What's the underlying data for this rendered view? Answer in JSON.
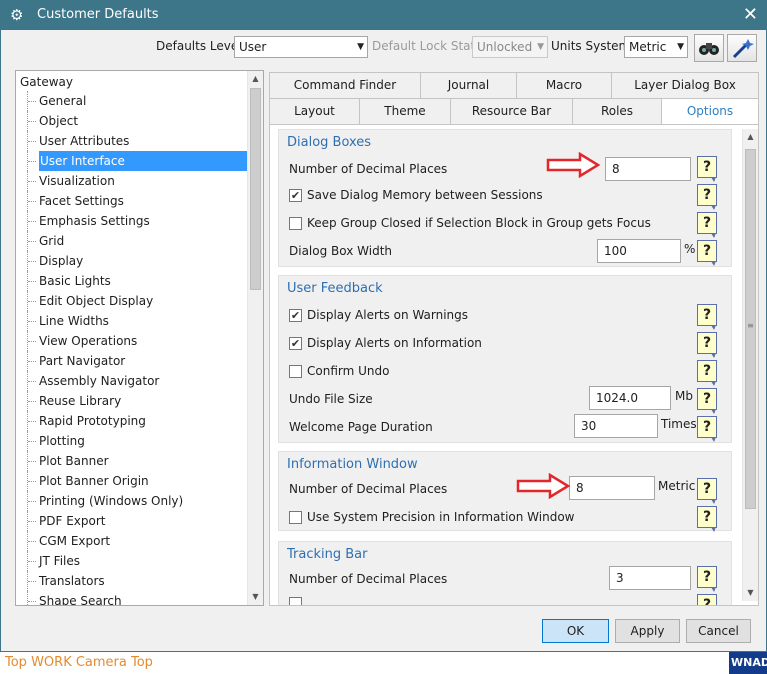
{
  "window": {
    "title": "Customer Defaults",
    "close_glyph": "✕",
    "app_icon_glyph": "⚙"
  },
  "toolbar": {
    "defaults_level_label": "Defaults Level",
    "defaults_level_value": "User",
    "lock_state_label": "Default Lock State",
    "lock_state_value": "Unlocked",
    "units_system_label": "Units System",
    "units_system_value": "Metric",
    "icon_buttons": [
      "binoculars-icon",
      "wand-icon"
    ]
  },
  "tree": {
    "root": "Gateway",
    "items": [
      "General",
      "Object",
      "User Attributes",
      "User Interface",
      "Visualization",
      "Facet Settings",
      "Emphasis Settings",
      "Grid",
      "Display",
      "Basic Lights",
      "Edit Object Display",
      "Line Widths",
      "View Operations",
      "Part Navigator",
      "Assembly Navigator",
      "Reuse Library",
      "Rapid Prototyping",
      "Plotting",
      "Plot Banner",
      "Plot Banner Origin",
      "Printing (Windows Only)",
      "PDF Export",
      "CGM Export",
      "JT Files",
      "Translators",
      "Shape Search"
    ],
    "selected_index": 3
  },
  "tabs": {
    "row1": [
      "Command Finder",
      "Journal",
      "Macro",
      "Layer Dialog Box"
    ],
    "row2": [
      "Layout",
      "Theme",
      "Resource Bar",
      "Roles",
      "Options"
    ],
    "active": "Options"
  },
  "dialog_boxes": {
    "title": "Dialog Boxes",
    "decimal_places_label": "Number of Decimal Places",
    "decimal_places_value": "8",
    "save_memory_label": "Save Dialog Memory between Sessions",
    "save_memory_checked": true,
    "keep_group_label": "Keep Group Closed if Selection Block in Group gets Focus",
    "keep_group_checked": false,
    "width_label": "Dialog Box Width",
    "width_value": "100",
    "width_unit": "%"
  },
  "user_feedback": {
    "title": "User Feedback",
    "alerts_warnings_label": "Display Alerts on Warnings",
    "alerts_warnings_checked": true,
    "alerts_info_label": "Display Alerts on Information",
    "alerts_info_checked": true,
    "confirm_undo_label": "Confirm Undo",
    "confirm_undo_checked": false,
    "undo_size_label": "Undo File Size",
    "undo_size_value": "1024.0",
    "undo_size_unit": "Mb",
    "welcome_label": "Welcome Page Duration",
    "welcome_value": "30",
    "welcome_unit": "Times"
  },
  "information_window": {
    "title": "Information Window",
    "decimal_places_label": "Number of Decimal Places",
    "decimal_places_value": "8",
    "decimal_places_unit": "Metric",
    "system_precision_label": "Use System Precision in Information Window",
    "system_precision_checked": false
  },
  "tracking_bar": {
    "title": "Tracking Bar",
    "decimal_places_label": "Number of Decimal Places",
    "decimal_places_value": "3"
  },
  "help_glyph": "?",
  "buttons": {
    "ok": "OK",
    "apply": "Apply",
    "cancel": "Cancel"
  },
  "taskbar": {
    "left_text": "Top WORK Camera Top",
    "right_text": "WNADV"
  },
  "colors": {
    "titlebar": "#3d7589",
    "selection": "#3399ff",
    "group_title": "#2f6fb1",
    "annotation_arrow": "#e3262a"
  }
}
